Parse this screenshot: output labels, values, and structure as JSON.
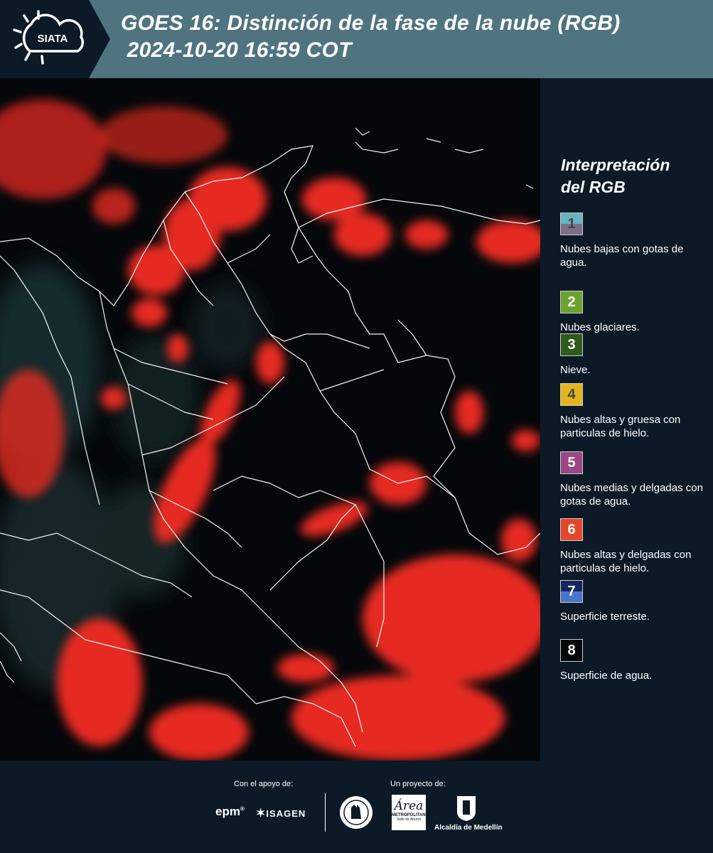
{
  "header": {
    "logo_text": "SIATA",
    "title_line1": "GOES 16: Distinción de la fase de la nube (RGB)",
    "title_line2": " 2024-10-20 16:59 COT",
    "background_color": "#4f7480"
  },
  "legend": {
    "title_line1": "Interpretación",
    "title_line2": "del RGB",
    "items": [
      {
        "number": "1",
        "label": "Nubes bajas con gotas de agua.",
        "color_top": "#66b3c2",
        "color_bottom": "#7c6e8a"
      },
      {
        "number": "2",
        "label": "Nubes glaciares.",
        "color_top": "#6ba22e",
        "color_bottom": "#6ba22e"
      },
      {
        "number": "3",
        "label": "Nieve.",
        "color_top": "#2f5a1e",
        "color_bottom": "#2f5a1e"
      },
      {
        "number": "4",
        "label": "Nubes altas y gruesa con particulas de hielo.",
        "color_top": "#e2b41e",
        "color_bottom": "#e2b41e"
      },
      {
        "number": "5",
        "label": "Nubes medias y delgadas con gotas de agua.",
        "color_top": "#9a4784",
        "color_bottom": "#9a4784"
      },
      {
        "number": "6",
        "label": "Nubes altas y delgadas con particulas de hielo.",
        "color_top": "#e5472a",
        "color_bottom": "#e5472a"
      },
      {
        "number": "7",
        "label": "Superficie terreste.",
        "color_top": "#16245e",
        "color_bottom": "#4a74c9"
      },
      {
        "number": "8",
        "label": "Superficie de agua.",
        "color_top": "#050908",
        "color_bottom": "#050908"
      }
    ]
  },
  "footer": {
    "support_label": "Con el apoyo de:",
    "project_label": "Un proyecto de:",
    "sponsor1": "epm",
    "sponsor2": "ISAGEN",
    "partner1": "METROPOLITANA",
    "partner1_sub": "Valle de Aburrá",
    "partner1_script": "Área",
    "partner2": "Alcaldía de Medellín"
  }
}
